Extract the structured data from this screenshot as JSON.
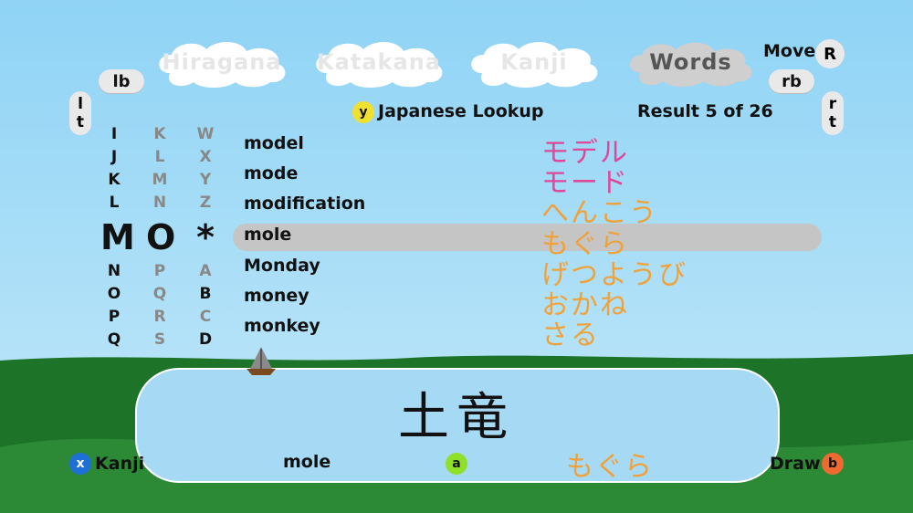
{
  "tabs": [
    {
      "label": "Hiragana",
      "active": false
    },
    {
      "label": "Katakana",
      "active": false
    },
    {
      "label": "Kanji",
      "active": false
    },
    {
      "label": "Words",
      "active": true
    }
  ],
  "buttons": {
    "lb": "lb",
    "rb": "rb",
    "lt": "lt",
    "rt": "rt",
    "move_label": "Move",
    "move_badge": "R"
  },
  "header": {
    "lookup_key": "y",
    "lookup_label": "Japanese Lookup",
    "result_text": "Result 5 of 26"
  },
  "letter_wheel": {
    "col1": [
      "I",
      "J",
      "K",
      "L",
      "M",
      "N",
      "O",
      "P",
      "Q"
    ],
    "col2": [
      "K",
      "L",
      "M",
      "N",
      "O",
      "P",
      "Q",
      "R",
      "S"
    ],
    "col3": [
      "W",
      "X",
      "Y",
      "Z",
      "*",
      "A",
      "B",
      "C",
      "D"
    ]
  },
  "results": [
    {
      "word": "model",
      "kana": "モデル",
      "color": "#e0469a"
    },
    {
      "word": "mode",
      "kana": "モード",
      "color": "#e0469a"
    },
    {
      "word": "modification",
      "kana": "へんこう",
      "color": "#f0a13a"
    },
    {
      "word": "mole",
      "kana": "もぐら",
      "color": "#f0a13a"
    },
    {
      "word": "Monday",
      "kana": "げつようび",
      "color": "#f0a13a"
    },
    {
      "word": "money",
      "kana": "おかね",
      "color": "#f0a13a"
    },
    {
      "word": "monkey",
      "kana": "さる",
      "color": "#f0a13a"
    }
  ],
  "selected_index": 3,
  "drawing": {
    "kanji": "土竜"
  },
  "footer": {
    "x_key": "x",
    "x_label": "Kanji",
    "word": "mole",
    "a_key": "a",
    "kana": "もぐら",
    "draw_label": "Draw",
    "b_key": "b"
  },
  "colors": {
    "sky": "#9dd8f6",
    "grass": "#1f7a2a",
    "key_x": "#1e6fd6",
    "key_y": "#f0e030",
    "key_a": "#8ee02a",
    "key_b": "#ee6a30",
    "katakana": "#e0469a",
    "hiragana": "#f0a13a"
  }
}
